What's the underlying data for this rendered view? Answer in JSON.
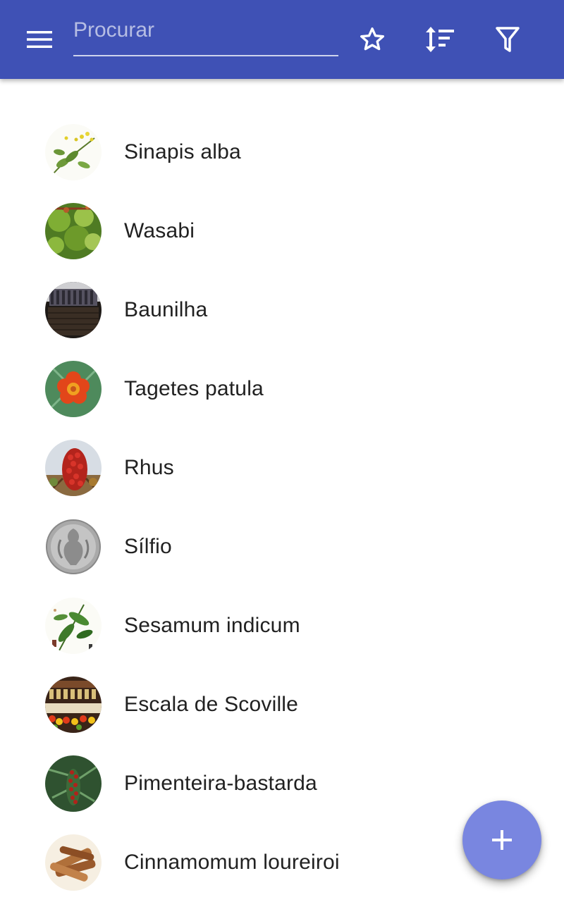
{
  "toolbar": {
    "background_color": "#3f51b5",
    "menu_icon": "menu-icon",
    "search_placeholder": "Procurar",
    "search_value": "",
    "favorite_icon": "star-outline-icon",
    "sort_icon": "sort-icon",
    "filter_icon": "filter-icon"
  },
  "items": [
    {
      "label": "Sinapis alba",
      "image": "botanical-illustration-mustard"
    },
    {
      "label": "Wasabi",
      "image": "green-leaves-photo"
    },
    {
      "label": "Baunilha",
      "image": "vanilla-pods-photo"
    },
    {
      "label": "Tagetes patula",
      "image": "orange-marigold-flower-photo"
    },
    {
      "label": "Rhus",
      "image": "red-berry-cluster-photo"
    },
    {
      "label": "Sílfio",
      "image": "silver-coin-photo"
    },
    {
      "label": "Sesamum indicum",
      "image": "botanical-illustration-sesame"
    },
    {
      "label": "Escala de Scoville",
      "image": "pepper-market-stall-photo"
    },
    {
      "label": "Pimenteira-bastarda",
      "image": "pepper-tree-berries-photo"
    },
    {
      "label": "Cinnamomum loureiroi",
      "image": "cinnamon-sticks-photo"
    }
  ],
  "fab": {
    "icon": "add-icon",
    "color": "#7986e0"
  }
}
